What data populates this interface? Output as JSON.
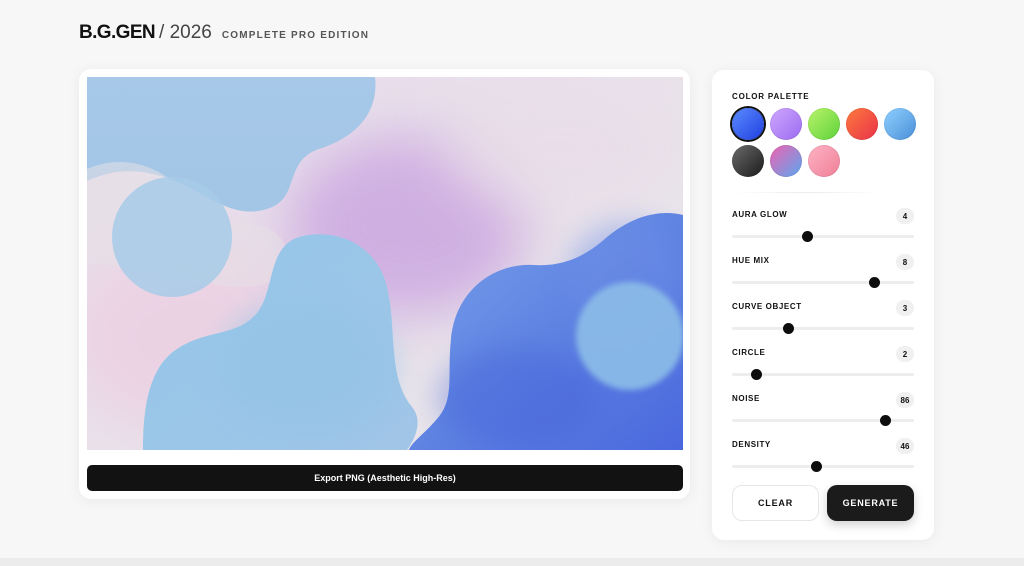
{
  "header": {
    "brand": "B.G.GEN",
    "year": "/ 2026",
    "edition": "COMPLETE PRO EDITION"
  },
  "canvas": {
    "export_label": "Export PNG (Aesthetic High-Res)"
  },
  "panel": {
    "palette_label": "COLOR PALETTE",
    "swatches": [
      {
        "name": "blue",
        "from": "#5b8cff",
        "to": "#1f3fe0",
        "selected": true
      },
      {
        "name": "violet",
        "from": "#cfa7ff",
        "to": "#9b6bf0"
      },
      {
        "name": "lime",
        "from": "#b9f46a",
        "to": "#5fd13b"
      },
      {
        "name": "sunset",
        "from": "#ff7a3d",
        "to": "#e8324a"
      },
      {
        "name": "sky",
        "from": "#8fd0ff",
        "to": "#4a8fd8"
      },
      {
        "name": "graphite",
        "from": "#6b6b6b",
        "to": "#1a1a1a"
      },
      {
        "name": "aurora",
        "from": "#f062b0",
        "to": "#5aa7f0"
      },
      {
        "name": "rose",
        "from": "#ffb3c4",
        "to": "#ef7f98"
      }
    ],
    "sliders": [
      {
        "label": "AURA GLOW",
        "value": "4",
        "fraction": 0.41
      },
      {
        "label": "HUE MIX",
        "value": "8",
        "fraction": 0.78
      },
      {
        "label": "CURVE OBJECT",
        "value": "3",
        "fraction": 0.31
      },
      {
        "label": "CIRCLE",
        "value": "2",
        "fraction": 0.13
      },
      {
        "label": "NOISE",
        "value": "86",
        "fraction": 0.84
      },
      {
        "label": "DENSITY",
        "value": "46",
        "fraction": 0.46
      }
    ],
    "clear_label": "CLEAR",
    "generate_label": "GENERATE"
  }
}
